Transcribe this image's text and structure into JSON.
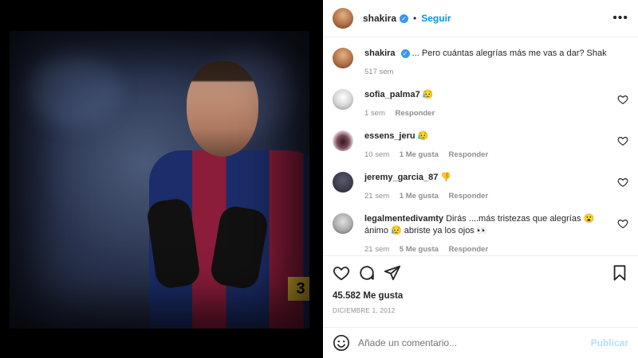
{
  "header": {
    "username": "shakira",
    "follow_label": "Seguir",
    "more_icon": "more-horizontal-icon"
  },
  "caption": {
    "username": "shakira",
    "text": "... Pero cuántas alegrías más me vas a dar? Shak",
    "time": "517 sem"
  },
  "comments": [
    {
      "username": "sofia_palma7",
      "text": "😥",
      "time": "1 sem",
      "likes": "",
      "reply": "Responder"
    },
    {
      "username": "essens_jeru",
      "text": "😥",
      "time": "10 sem",
      "likes": "1 Me gusta",
      "reply": "Responder"
    },
    {
      "username": "jeremy_garcia_87",
      "text": "👎",
      "time": "21 sem",
      "likes": "1 Me gusta",
      "reply": "Responder"
    },
    {
      "username": "legalmentedivamty",
      "text": "Dirás ....más tristezas que alegrías 😮 ánimo 😥 abriste ya los ojos 👀",
      "time": "21 sem",
      "likes": "5 Me gusta",
      "reply": "Responder"
    }
  ],
  "footer": {
    "likes": "45.582 Me gusta",
    "date": "DICIEMBRE 1, 2012"
  },
  "add_comment": {
    "placeholder": "Añade un comentario...",
    "publish_label": "Publicar"
  },
  "colors": {
    "accent": "#0095f6",
    "publish_disabled": "#b2dffc",
    "muted": "#8e8e8e"
  }
}
